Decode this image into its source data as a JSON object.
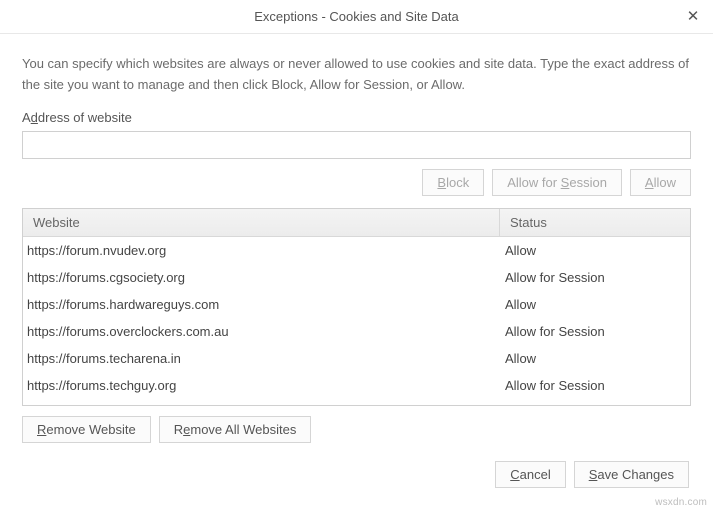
{
  "window": {
    "title": "Exceptions - Cookies and Site Data",
    "close_glyph": "✕"
  },
  "description": "You can specify which websites are always or never allowed to use cookies and site data. Type the exact address of the site you want to manage and then click Block, Allow for Session, or Allow.",
  "address": {
    "label_pre": "A",
    "label_u": "d",
    "label_post": "dress of website",
    "value": ""
  },
  "buttons": {
    "block_pre": "",
    "block_u": "B",
    "block_post": "lock",
    "session_pre": "Allow for ",
    "session_u": "S",
    "session_post": "ession",
    "allow_pre": "",
    "allow_u": "A",
    "allow_post": "llow"
  },
  "table": {
    "header_site": "Website",
    "header_status": "Status",
    "rows": [
      {
        "site": "https://forum.nvudev.org",
        "status": "Allow"
      },
      {
        "site": "https://forums.cgsociety.org",
        "status": "Allow for Session"
      },
      {
        "site": "https://forums.hardwareguys.com",
        "status": "Allow"
      },
      {
        "site": "https://forums.overclockers.com.au",
        "status": "Allow for Session"
      },
      {
        "site": "https://forums.techarena.in",
        "status": "Allow"
      },
      {
        "site": "https://forums.techguy.org",
        "status": "Allow for Session"
      }
    ]
  },
  "footer": {
    "remove_pre": "",
    "remove_u": "R",
    "remove_post": "emove Website",
    "removeall_pre": "R",
    "removeall_u": "e",
    "removeall_post": "move All Websites",
    "cancel_pre": "",
    "cancel_u": "C",
    "cancel_post": "ancel",
    "save_pre": "",
    "save_u": "S",
    "save_post": "ave Changes"
  },
  "watermark": "wsxdn.com"
}
